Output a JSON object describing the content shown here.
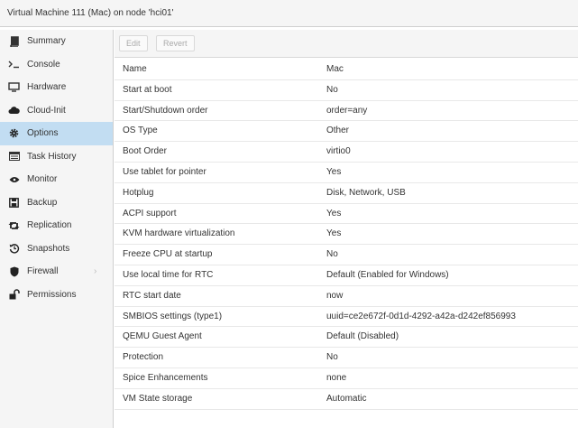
{
  "window": {
    "title": "Virtual Machine 111 (Mac) on node 'hci01'"
  },
  "sidebar": {
    "items": [
      {
        "label": "Summary",
        "icon": "book-icon"
      },
      {
        "label": "Console",
        "icon": "terminal-icon"
      },
      {
        "label": "Hardware",
        "icon": "monitor-icon"
      },
      {
        "label": "Cloud-Init",
        "icon": "cloud-icon"
      },
      {
        "label": "Options",
        "icon": "gear-icon",
        "active": true
      },
      {
        "label": "Task History",
        "icon": "list-icon"
      },
      {
        "label": "Monitor",
        "icon": "eye-icon"
      },
      {
        "label": "Backup",
        "icon": "floppy-icon"
      },
      {
        "label": "Replication",
        "icon": "retweet-icon"
      },
      {
        "label": "Snapshots",
        "icon": "history-icon"
      },
      {
        "label": "Firewall",
        "icon": "shield-icon",
        "expandable": true
      },
      {
        "label": "Permissions",
        "icon": "unlock-icon"
      }
    ]
  },
  "toolbar": {
    "edit_label": "Edit",
    "revert_label": "Revert"
  },
  "options": [
    {
      "name": "Name",
      "value": "Mac"
    },
    {
      "name": "Start at boot",
      "value": "No"
    },
    {
      "name": "Start/Shutdown order",
      "value": "order=any"
    },
    {
      "name": "OS Type",
      "value": "Other"
    },
    {
      "name": "Boot Order",
      "value": "virtio0"
    },
    {
      "name": "Use tablet for pointer",
      "value": "Yes"
    },
    {
      "name": "Hotplug",
      "value": "Disk, Network, USB"
    },
    {
      "name": "ACPI support",
      "value": "Yes"
    },
    {
      "name": "KVM hardware virtualization",
      "value": "Yes"
    },
    {
      "name": "Freeze CPU at startup",
      "value": "No"
    },
    {
      "name": "Use local time for RTC",
      "value": "Default (Enabled for Windows)"
    },
    {
      "name": "RTC start date",
      "value": "now"
    },
    {
      "name": "SMBIOS settings (type1)",
      "value": "uuid=ce2e672f-0d1d-4292-a42a-d242ef856993"
    },
    {
      "name": "QEMU Guest Agent",
      "value": "Default (Disabled)"
    },
    {
      "name": "Protection",
      "value": "No"
    },
    {
      "name": "Spice Enhancements",
      "value": "none"
    },
    {
      "name": "VM State storage",
      "value": "Automatic"
    }
  ],
  "colors": {
    "active_item_bg": "#c2ddf2",
    "sidebar_bg": "#f5f5f5",
    "row_border": "#e8e8e8"
  }
}
